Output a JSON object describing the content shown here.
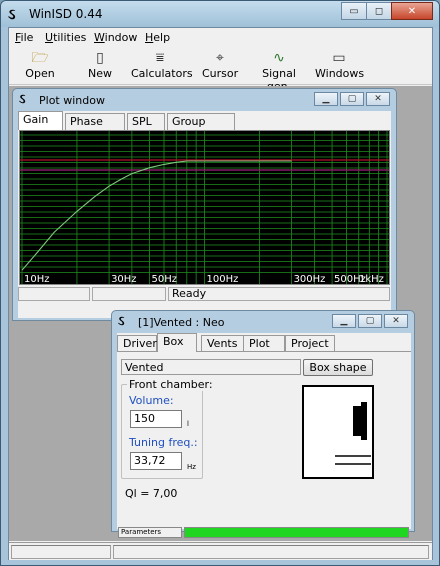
{
  "app": {
    "title": "WinISD 0.44",
    "caption_buttons": {
      "minimize": "▭",
      "maximize": "◻",
      "close": "✕"
    }
  },
  "menu": [
    {
      "label": "File",
      "u": "F",
      "rest": "ile"
    },
    {
      "label": "Utilities",
      "u": "U",
      "rest": "tilities"
    },
    {
      "label": "Window",
      "u": "W",
      "rest": "indow"
    },
    {
      "label": "Help",
      "u": "H",
      "rest": "elp"
    }
  ],
  "toolbar": {
    "open": {
      "label": "Open",
      "icon": "folder-open-icon"
    },
    "new": {
      "label": "New",
      "icon": "new-document-icon"
    },
    "calculators": {
      "label": "Calculators",
      "icon": "calculator-icon"
    },
    "cursor": {
      "label": "Cursor",
      "icon": "crosshair-icon"
    },
    "signal_gen": {
      "label": "Signal gen.",
      "icon": "sine-wave-icon"
    },
    "windows": {
      "label": "Windows",
      "icon": "window-icon"
    }
  },
  "plot_window": {
    "title": "Plot window",
    "tabs": [
      "Gain",
      "Phase plot",
      "SPL",
      "Group delay"
    ],
    "active_tab": "Gain",
    "status_text": "Ready",
    "x_tick_labels": [
      "10Hz",
      "30Hz",
      "50Hz",
      "100Hz",
      "300Hz",
      "500Hz",
      "1kHz"
    ],
    "colors": {
      "background": "#000000",
      "grid": "#1f8f1f",
      "curve": "#7ec87e",
      "ref_line_red": "#b2102a",
      "ref_line_magenta": "#a0207a"
    }
  },
  "chart_data": {
    "type": "line",
    "title": "",
    "xlabel": "",
    "ylabel": "",
    "x_scale": "log",
    "xlim": [
      10,
      1000
    ],
    "x_ticks": [
      "10Hz",
      "30Hz",
      "50Hz",
      "100Hz",
      "300Hz",
      "500Hz",
      "1kHz"
    ],
    "series": [
      {
        "x": [
          10,
          12,
          15,
          20,
          25,
          30,
          35,
          40,
          50,
          60,
          70,
          80,
          100,
          150,
          200,
          300
        ],
        "y": [
          -26,
          -22,
          -17,
          -12,
          -8.5,
          -6,
          -4.3,
          -3,
          -1.6,
          -0.8,
          -0.3,
          0,
          0,
          0,
          0,
          0
        ]
      }
    ]
  },
  "vented_window": {
    "title": "[1]Vented : Neo",
    "tabs": [
      "Driver",
      "Box",
      "Vents",
      "Plot",
      "Project"
    ],
    "active_tab": "Box",
    "box_type": "Vented",
    "box_shape_button": "Box shape",
    "front_chamber_label": "Front chamber:",
    "volume_label": "Volume:",
    "volume_value": "150",
    "volume_unit": "l",
    "tuning_label": "Tuning freq.:",
    "tuning_value": "33,72",
    "tuning_unit": "Hz",
    "ql_text": "Ql = 7,00",
    "parameters_label": "Parameters",
    "progress": 1.0
  }
}
